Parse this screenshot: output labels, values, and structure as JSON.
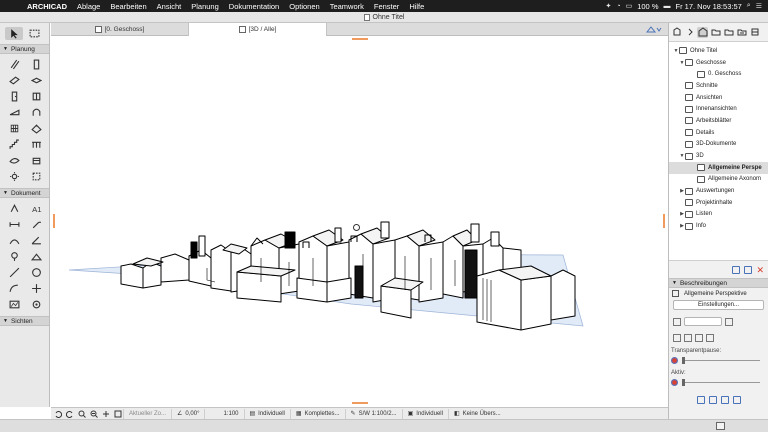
{
  "menubar": {
    "apple_icon": "apple-icon",
    "items": [
      "ARCHICAD",
      "Ablage",
      "Bearbeiten",
      "Ansicht",
      "Planung",
      "Dokumentation",
      "Optionen",
      "Teamwork",
      "Fenster",
      "Hilfe"
    ],
    "battery": "100 %",
    "datetime": "Fr 17. Nov  18:53:57"
  },
  "window": {
    "title": "Ohne Titel"
  },
  "toolbox": {
    "sections": [
      "Planung",
      "Dokument",
      "Sichten"
    ]
  },
  "tabs": [
    {
      "label": "[0. Geschoss]",
      "active": false
    },
    {
      "label": "[3D / Alle]",
      "active": true
    }
  ],
  "statusbar": {
    "zoom_label": "Aktueller Zo...",
    "angle": "0,00°",
    "scale": "1:100",
    "layer_combo": "Individuell",
    "model_view": "Komplettes...",
    "pen_set": "S/W 1:100/2...",
    "renovation": "Individuell",
    "graphic_override": "Keine Übers..."
  },
  "navigator": {
    "tree": [
      {
        "label": "Ohne Titel",
        "level": 0,
        "expanded": true
      },
      {
        "label": "Geschosse",
        "level": 1,
        "expanded": true
      },
      {
        "label": "0. Geschoss",
        "level": 2
      },
      {
        "label": "Schnitte",
        "level": 1
      },
      {
        "label": "Ansichten",
        "level": 1
      },
      {
        "label": "Innenansichten",
        "level": 1
      },
      {
        "label": "Arbeitsblätter",
        "level": 1
      },
      {
        "label": "Details",
        "level": 1
      },
      {
        "label": "3D-Dokumente",
        "level": 1
      },
      {
        "label": "3D",
        "level": 1,
        "expanded": true
      },
      {
        "label": "Allgemeine Perspe",
        "level": 2,
        "selected": true,
        "bold": true
      },
      {
        "label": "Allgemeine Axonom",
        "level": 2
      },
      {
        "label": "Auswertungen",
        "level": 1,
        "collapsed": true
      },
      {
        "label": "Projektinhalte",
        "level": 1
      },
      {
        "label": "Listen",
        "level": 1,
        "collapsed": true
      },
      {
        "label": "Info",
        "level": 1,
        "collapsed": true
      }
    ],
    "section_title": "Beschreibungen",
    "current_view": "Allgemeine Perspektive",
    "settings_button": "Einstellungen...",
    "transparent_label": "Transparentpause:",
    "active_label": "Aktiv:"
  },
  "colors": {
    "accent_blue": "#4a72b8",
    "edge_marker": "#f19a5e",
    "close_red": "#d83b2a",
    "ground_plane": "#dfe8f6"
  }
}
